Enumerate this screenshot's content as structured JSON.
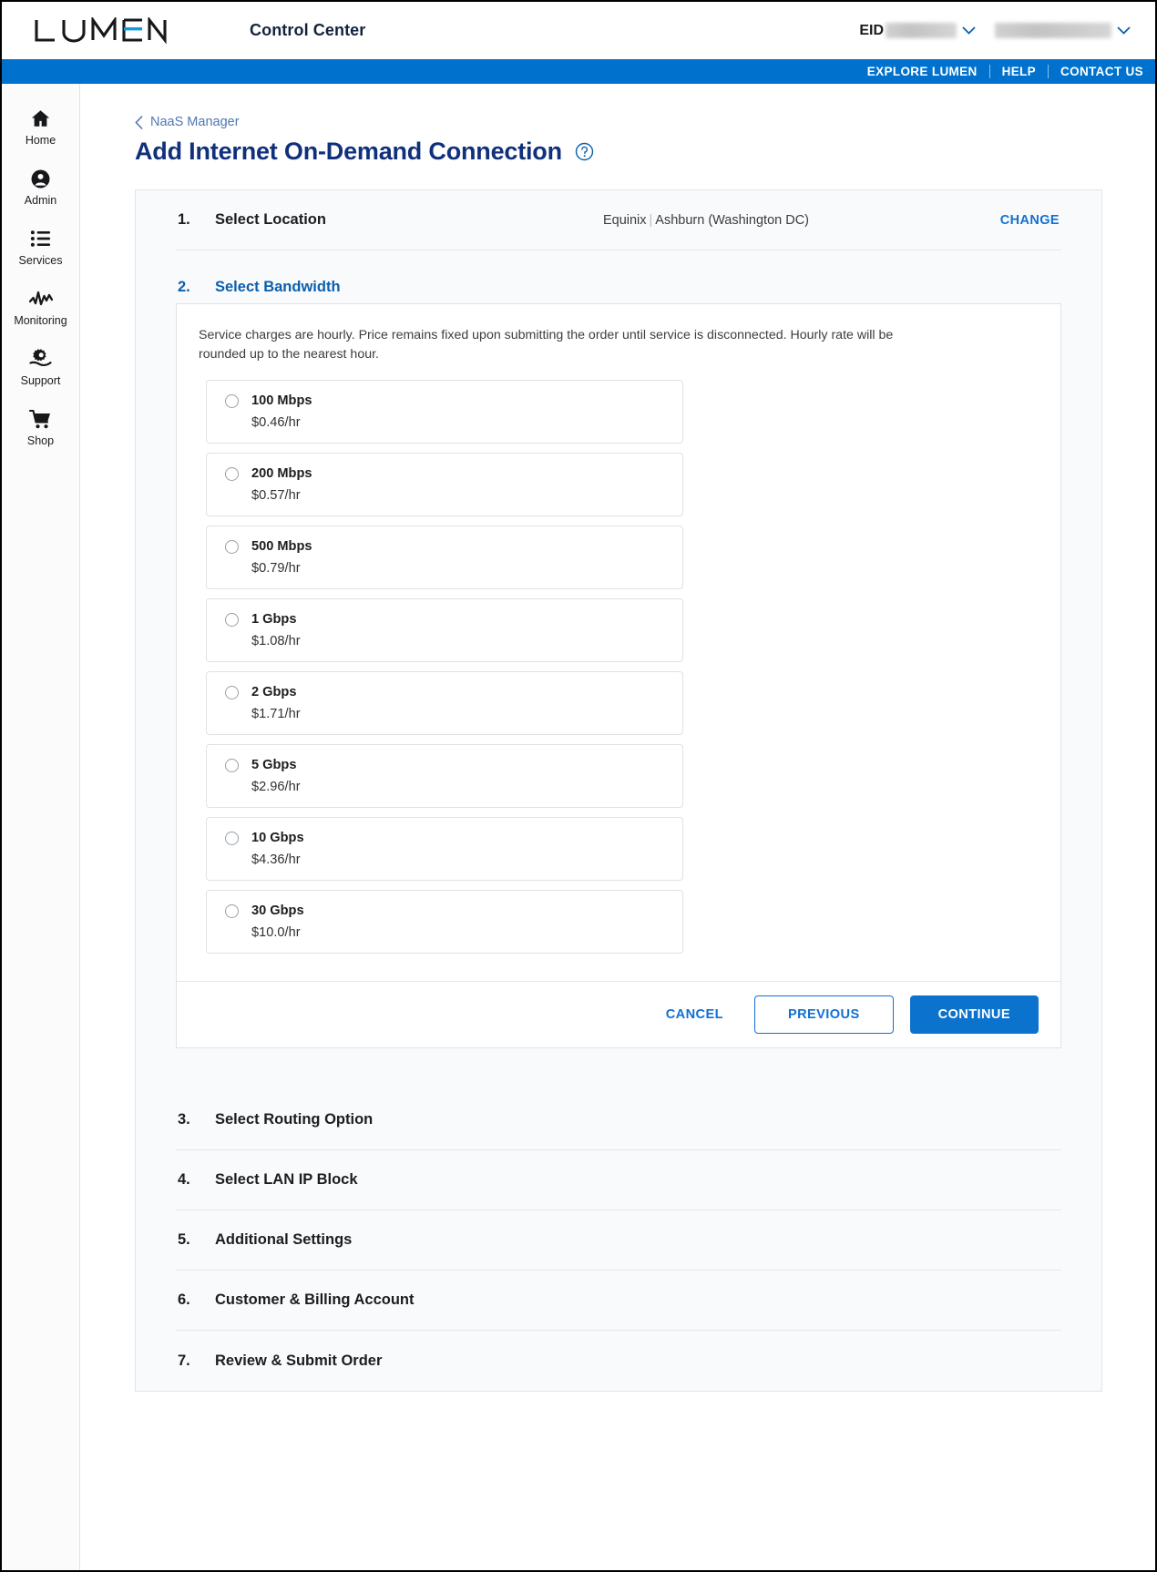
{
  "header": {
    "logo_text": "LUMEN",
    "app_title": "Control Center",
    "eid_label": "EID",
    "eid_value": "",
    "account_value": "",
    "nav": [
      {
        "label": "EXPLORE LUMEN"
      },
      {
        "label": "HELP"
      },
      {
        "label": "CONTACT US"
      }
    ]
  },
  "sidebar": {
    "items": [
      {
        "label": "Home",
        "icon": "home-icon"
      },
      {
        "label": "Admin",
        "icon": "user-circle-icon"
      },
      {
        "label": "Services",
        "icon": "list-icon"
      },
      {
        "label": "Monitoring",
        "icon": "activity-icon"
      },
      {
        "label": "Support",
        "icon": "gear-hand-icon"
      },
      {
        "label": "Shop",
        "icon": "cart-icon"
      }
    ]
  },
  "page": {
    "breadcrumb": "NaaS Manager",
    "title": "Add Internet On-Demand Connection",
    "help_icon": "question-circle-icon"
  },
  "steps": [
    {
      "num": "1.",
      "name": "Select Location",
      "value": "Equinix | Ashburn (Washington DC)",
      "value_left": "Equinix",
      "value_right": "Ashburn (Washington DC)",
      "action": "CHANGE",
      "state": "complete"
    },
    {
      "num": "2.",
      "name": "Select Bandwidth",
      "state": "active"
    },
    {
      "num": "3.",
      "name": "Select Routing Option",
      "state": "pending"
    },
    {
      "num": "4.",
      "name": "Select LAN IP Block",
      "state": "pending"
    },
    {
      "num": "5.",
      "name": "Additional Settings",
      "state": "pending"
    },
    {
      "num": "6.",
      "name": "Customer & Billing Account",
      "state": "pending"
    },
    {
      "num": "7.",
      "name": "Review & Submit Order",
      "state": "pending"
    }
  ],
  "bandwidth": {
    "note": "Service charges are hourly. Price remains fixed upon submitting the order until service is disconnected. Hourly rate will be rounded up to the nearest hour.",
    "options": [
      {
        "label": "100 Mbps",
        "price": "$0.46/hr",
        "selected": false
      },
      {
        "label": "200 Mbps",
        "price": "$0.57/hr",
        "selected": false
      },
      {
        "label": "500 Mbps",
        "price": "$0.79/hr",
        "selected": false
      },
      {
        "label": "1 Gbps",
        "price": "$1.08/hr",
        "selected": false
      },
      {
        "label": "2 Gbps",
        "price": "$1.71/hr",
        "selected": false
      },
      {
        "label": "5 Gbps",
        "price": "$2.96/hr",
        "selected": false
      },
      {
        "label": "10 Gbps",
        "price": "$4.36/hr",
        "selected": false
      },
      {
        "label": "30 Gbps",
        "price": "$10.0/hr",
        "selected": false
      }
    ],
    "buttons": {
      "cancel": "CANCEL",
      "previous": "PREVIOUS",
      "continue": "CONTINUE"
    }
  },
  "colors": {
    "brand_blue": "#0072cd",
    "title_navy": "#10307c",
    "link_blue": "#1170d4",
    "panel_bg": "#f9fafb"
  }
}
